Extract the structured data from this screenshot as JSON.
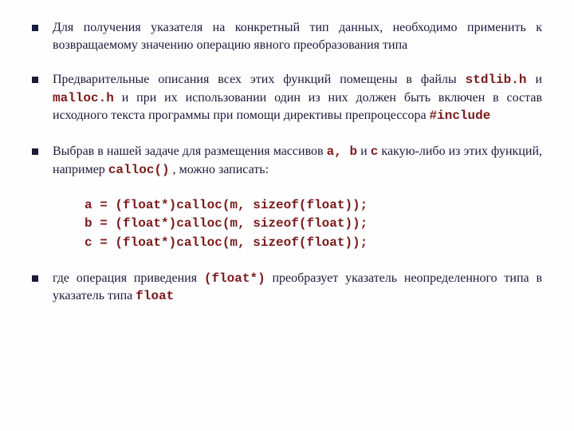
{
  "bullets": {
    "b1": "Для получения указателя на конкретный тип данных, необходимо применить к возвращаемому значению операцию явного преобразования типа",
    "b2_p1": "Предварительные описания всех этих функций помещены в файлы ",
    "b2_c1": "stdlib.h",
    "b2_p2": " и ",
    "b2_c2": "malloc.h",
    "b2_p3": " и при их использовании один из них должен быть включен в состав исходного текста программы при помощи директивы препроцессора ",
    "b2_c3": "#include",
    "b3_p1": "Выбрав в нашей задаче для размещения массивов ",
    "b3_c1": "a, b",
    "b3_p2": " и ",
    "b3_c2": "c",
    "b3_p3": " какую-либо из этих функций, например ",
    "b3_c3": "calloc()",
    "b3_p4": " , можно записать:",
    "b4_p1": "где операция приведения ",
    "b4_c1": "(float*)",
    "b4_p2": " преобразует указатель неопределенного типа в указатель типа ",
    "b4_c2": "float"
  },
  "code": "a = (float*)calloc(m, sizeof(float));\nb = (float*)calloc(m, sizeof(float));\nc = (float*)calloc(m, sizeof(float));"
}
